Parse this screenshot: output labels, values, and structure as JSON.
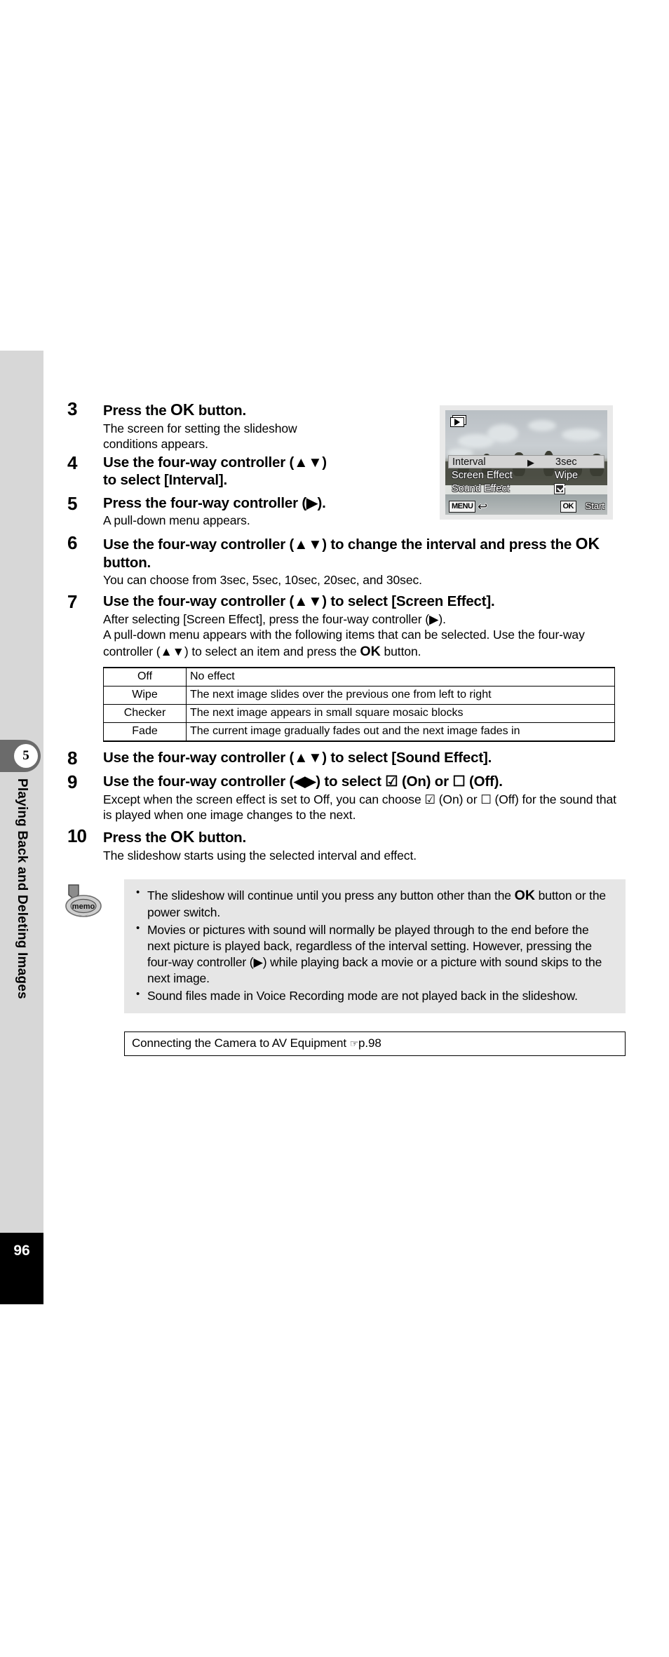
{
  "sidebar": {
    "chapter_number": "5",
    "chapter_title": "Playing Back and Deleting Images",
    "page_number": "96"
  },
  "steps": [
    {
      "number": "3",
      "heading_pre": "Press the ",
      "heading_ok": "OK",
      "heading_post": " button.",
      "description": "The screen for setting the slideshow conditions appears."
    },
    {
      "number": "4",
      "heading": "Use the four-way controller (▲▼) to select [Interval]."
    },
    {
      "number": "5",
      "heading": "Press the four-way controller (▶).",
      "description": "A pull-down menu appears."
    },
    {
      "number": "6",
      "heading_pre": "Use the four-way controller (▲▼) to change the interval and press the ",
      "heading_ok": "OK",
      "heading_post": " button.",
      "description": "You can choose from 3sec, 5sec, 10sec, 20sec, and 30sec."
    },
    {
      "number": "7",
      "heading": "Use the four-way controller (▲▼) to select [Screen Effect].",
      "description_line1": "After selecting [Screen Effect], press the four-way controller (▶).",
      "description_line2": "A pull-down menu appears with the following items that can be selected. Use the four-way controller (▲▼) to select an item and press the ",
      "description_ok": "OK",
      "description_line3": " button."
    },
    {
      "number": "8",
      "heading": "Use the four-way controller (▲▼) to select [Sound Effect]."
    },
    {
      "number": "9",
      "heading_a": "Use the four-way controller (◀▶) to select ",
      "heading_check": "☑",
      "heading_b": " (On) or ",
      "heading_box": "☐",
      "heading_c": " (Off).",
      "description_a": "Except when the screen effect is set to Off, you can choose ",
      "description_check": "☑",
      "description_b": " (On) or ",
      "description_box": "☐",
      "description_c": " (Off) for the sound that is played when one image changes to the next."
    },
    {
      "number": "10",
      "heading_pre": "Press the ",
      "heading_ok": "OK",
      "heading_post": " button.",
      "description": "The slideshow starts using the selected interval and effect."
    }
  ],
  "effects_table": {
    "rows": [
      {
        "name": "Off",
        "desc": "No effect"
      },
      {
        "name": "Wipe",
        "desc": "The next image slides over the previous one from left to right"
      },
      {
        "name": "Checker",
        "desc": "The next image appears in small square mosaic blocks"
      },
      {
        "name": "Fade",
        "desc": "The current image gradually fades out and the next image fades in"
      }
    ]
  },
  "memo": {
    "icon_label": "memo",
    "items": [
      {
        "pre": "The slideshow will continue until you press any button other than the ",
        "ok": "OK",
        "post": " button or the power switch."
      },
      {
        "pre": "Movies or pictures with sound will normally be played through to the end before the next picture is played back, regardless of the interval setting. However, pressing the four-way controller (▶) while playing back a movie or a picture with sound skips to the next image.",
        "ok": "",
        "post": ""
      },
      {
        "pre": "Sound files made in Voice Recording mode are not played back in the slideshow.",
        "ok": "",
        "post": ""
      }
    ]
  },
  "xref": {
    "text": "Connecting the Camera to AV Equipment ",
    "hand_icon": "☞",
    "page_ref": "p.98"
  },
  "lcd": {
    "playback_icon": "playback-mode-icon",
    "rows": [
      {
        "label": "Interval",
        "value": "3sec",
        "caret": "▶",
        "selected": true
      },
      {
        "label": "Screen Effect",
        "value": "Wipe",
        "caret": "",
        "selected": false
      },
      {
        "label": "Sound Effect",
        "value": "",
        "caret": "",
        "selected": false,
        "checkbox": true
      }
    ],
    "menu_key": "MENU",
    "back_arrow": "↩",
    "ok_key": "OK",
    "start_label": "Start"
  }
}
